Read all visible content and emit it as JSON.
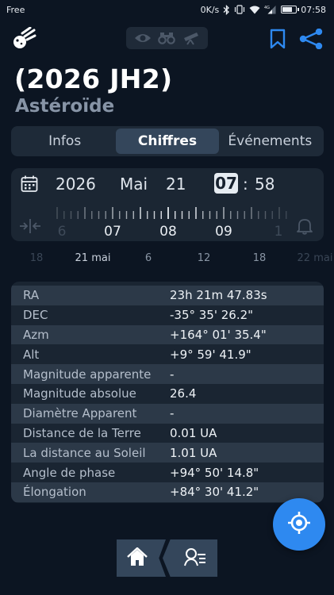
{
  "status_bar": {
    "carrier": "Free",
    "speed": "0K/s",
    "network": "4G",
    "time": "07:58",
    "battery_level": 0.8
  },
  "top_bar": {
    "icons": [
      "comet-logo-icon",
      "eye-icon",
      "binoculars-icon",
      "telescope-icon",
      "bookmark-icon",
      "share-icon"
    ],
    "accent_color": "#2e89f0"
  },
  "object": {
    "name": "(2026 JH2)",
    "type": "Astéroïde"
  },
  "tabs": [
    {
      "label": "Infos",
      "active": false
    },
    {
      "label": "Chiffres",
      "active": true
    },
    {
      "label": "Événements",
      "active": false
    }
  ],
  "datetime": {
    "year": "2026",
    "month": "Mai",
    "day": "21",
    "hour": "07",
    "separator": ":",
    "minute": "58",
    "ruler_labels": [
      "6",
      "07",
      "08",
      "09",
      "1"
    ]
  },
  "timeline": {
    "labels": [
      "18",
      "21 mai",
      "6",
      "12",
      "18",
      "22 mai"
    ]
  },
  "table": [
    {
      "key": "RA",
      "value": "23h 21m 47.83s"
    },
    {
      "key": "DEC",
      "value": "-35° 35' 26.2\""
    },
    {
      "key": "Azm",
      "value": "+164° 01' 35.4\""
    },
    {
      "key": "Alt",
      "value": "+9° 59' 41.9\""
    },
    {
      "key": "Magnitude apparente",
      "value": "-"
    },
    {
      "key": "Magnitude absolue",
      "value": "26.4"
    },
    {
      "key": "Diamètre Apparent",
      "value": "-"
    },
    {
      "key": "Distance de la Terre",
      "value": "0.01 UA"
    },
    {
      "key": "La distance au Soleil",
      "value": "1.01 UA"
    },
    {
      "key": "Angle de phase",
      "value": "+94° 50' 14.8\""
    },
    {
      "key": "Élongation",
      "value": "+84° 30' 41.2\""
    }
  ],
  "bottom_nav": {
    "icons": [
      "home-icon",
      "object-list-icon"
    ]
  }
}
